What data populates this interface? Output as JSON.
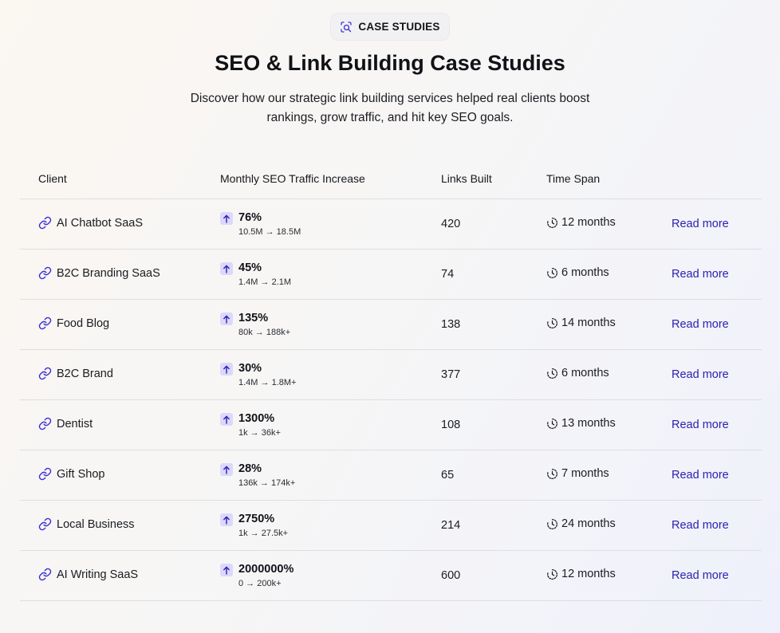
{
  "badge": {
    "label": "CASE STUDIES",
    "icon": "search-document-icon"
  },
  "title": "SEO & Link Building Case Studies",
  "subtitle_line1": "Discover how our strategic link building services helped real clients boost",
  "subtitle_line2": "rankings, grow traffic, and hit key SEO goals.",
  "colors": {
    "accent": "#2a1fb0",
    "arrow_bg": "#dcd8fb",
    "icon": "#3b2fd6"
  },
  "table": {
    "headers": {
      "client": "Client",
      "traffic": "Monthly SEO Traffic Increase",
      "links": "Links Built",
      "timespan": "Time Span"
    },
    "rows": [
      {
        "client": "AI Chatbot SaaS",
        "pct": "76%",
        "range": "10.5M → 18.5M",
        "links": "420",
        "timespan": "12 months",
        "action": "Read more"
      },
      {
        "client": "B2C Branding SaaS",
        "pct": "45%",
        "range": "1.4M → 2.1M",
        "links": "74",
        "timespan": "6 months",
        "action": "Read more"
      },
      {
        "client": "Food Blog",
        "pct": "135%",
        "range": "80k → 188k+",
        "links": "138",
        "timespan": "14 months",
        "action": "Read more"
      },
      {
        "client": "B2C Brand",
        "pct": "30%",
        "range": "1.4M → 1.8M+",
        "links": "377",
        "timespan": "6 months",
        "action": "Read more"
      },
      {
        "client": "Dentist",
        "pct": "1300%",
        "range": "1k → 36k+",
        "links": "108",
        "timespan": "13 months",
        "action": "Read more"
      },
      {
        "client": "Gift Shop",
        "pct": "28%",
        "range": "136k → 174k+",
        "links": "65",
        "timespan": "7 months",
        "action": "Read more"
      },
      {
        "client": "Local Business",
        "pct": "2750%",
        "range": "1k → 27.5k+",
        "links": "214",
        "timespan": "24 months",
        "action": "Read more"
      },
      {
        "client": "AI Writing SaaS",
        "pct": "2000000%",
        "range": "0 → 200k+",
        "links": "600",
        "timespan": "12 months",
        "action": "Read more"
      }
    ]
  }
}
